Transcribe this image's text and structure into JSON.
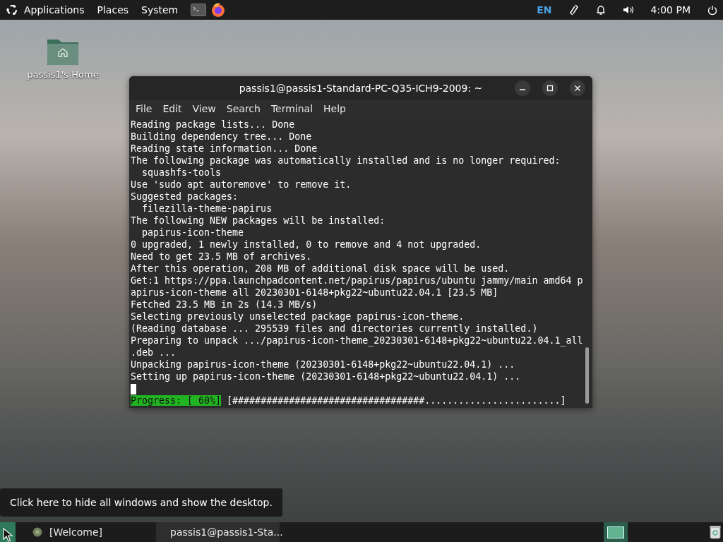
{
  "top_panel": {
    "menus": [
      "Applications",
      "Places",
      "System"
    ],
    "language": "EN",
    "clock": "4:00 PM"
  },
  "desktop_icons": [
    {
      "label": "passis1's Home"
    }
  ],
  "window": {
    "title": "passis1@passis1-Standard-PC-Q35-ICH9-2009: ~",
    "menu": [
      "File",
      "Edit",
      "View",
      "Search",
      "Terminal",
      "Help"
    ],
    "lines": [
      "Reading package lists... Done",
      "Building dependency tree... Done",
      "Reading state information... Done",
      "The following package was automatically installed and is no longer required:",
      "  squashfs-tools",
      "Use 'sudo apt autoremove' to remove it.",
      "Suggested packages:",
      "  filezilla-theme-papirus",
      "The following NEW packages will be installed:",
      "  papirus-icon-theme",
      "0 upgraded, 1 newly installed, 0 to remove and 4 not upgraded.",
      "Need to get 23.5 MB of archives.",
      "After this operation, 208 MB of additional disk space will be used.",
      "Get:1 https://ppa.launchpadcontent.net/papirus/papirus/ubuntu jammy/main amd64 p",
      "apirus-icon-theme all 20230301-6148+pkg22~ubuntu22.04.1 [23.5 MB]",
      "Fetched 23.5 MB in 2s (14.3 MB/s)",
      "Selecting previously unselected package papirus-icon-theme.",
      "(Reading database ... 295539 files and directories currently installed.)",
      "Preparing to unpack .../papirus-icon-theme_20230301-6148+pkg22~ubuntu22.04.1_all",
      ".deb ...",
      "Unpacking papirus-icon-theme (20230301-6148+pkg22~ubuntu22.04.1) ...",
      "Setting up papirus-icon-theme (20230301-6148+pkg22~ubuntu22.04.1) ..."
    ],
    "progress_label": "Progress: [ 60%]",
    "progress_bar": "[##################################........................]"
  },
  "tooltip": "Click here to hide all windows and show the desktop.",
  "taskbar": {
    "tasks": [
      {
        "kind": "welcome",
        "label": "[Welcome]",
        "selected": false
      },
      {
        "kind": "terminal",
        "label": "passis1@passis1-Sta...",
        "selected": true
      }
    ]
  }
}
